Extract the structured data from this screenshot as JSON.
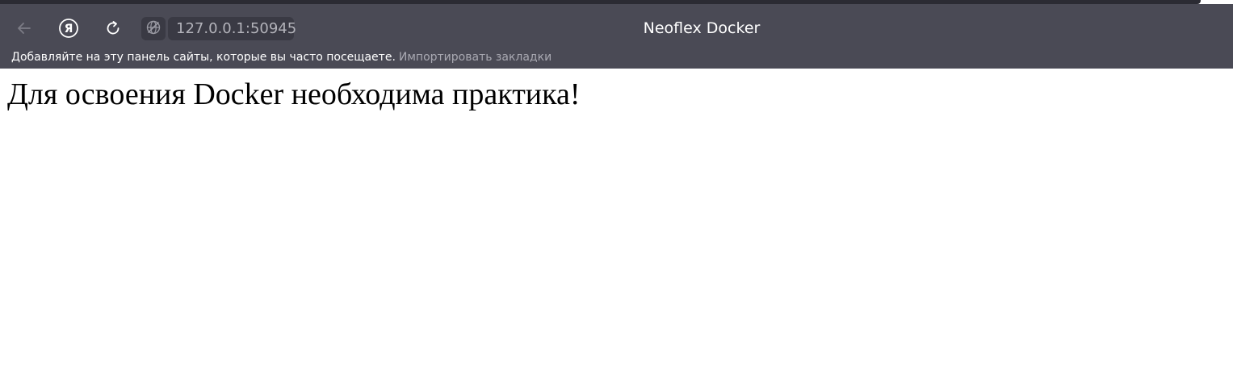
{
  "browser": {
    "toolbar": {
      "back_icon": "arrow-left-icon",
      "yandex_icon": "yandex-logo-icon",
      "reload_icon": "reload-icon",
      "site_info_icon": "globe-slashed-icon",
      "address": "127.0.0.1:50945"
    },
    "tab_title": "Neoflex Docker",
    "bookmarks_bar": {
      "hint": "Добавляйте на эту панель сайты, которые вы часто посещаете.",
      "import_link": "Импортировать закладки"
    }
  },
  "page": {
    "heading": "Для освоения Docker необходима практика!"
  },
  "colors": {
    "toolbar_bg": "#4a4a55",
    "address_bg": "#3a3a44",
    "page_bg": "#ffffff"
  }
}
